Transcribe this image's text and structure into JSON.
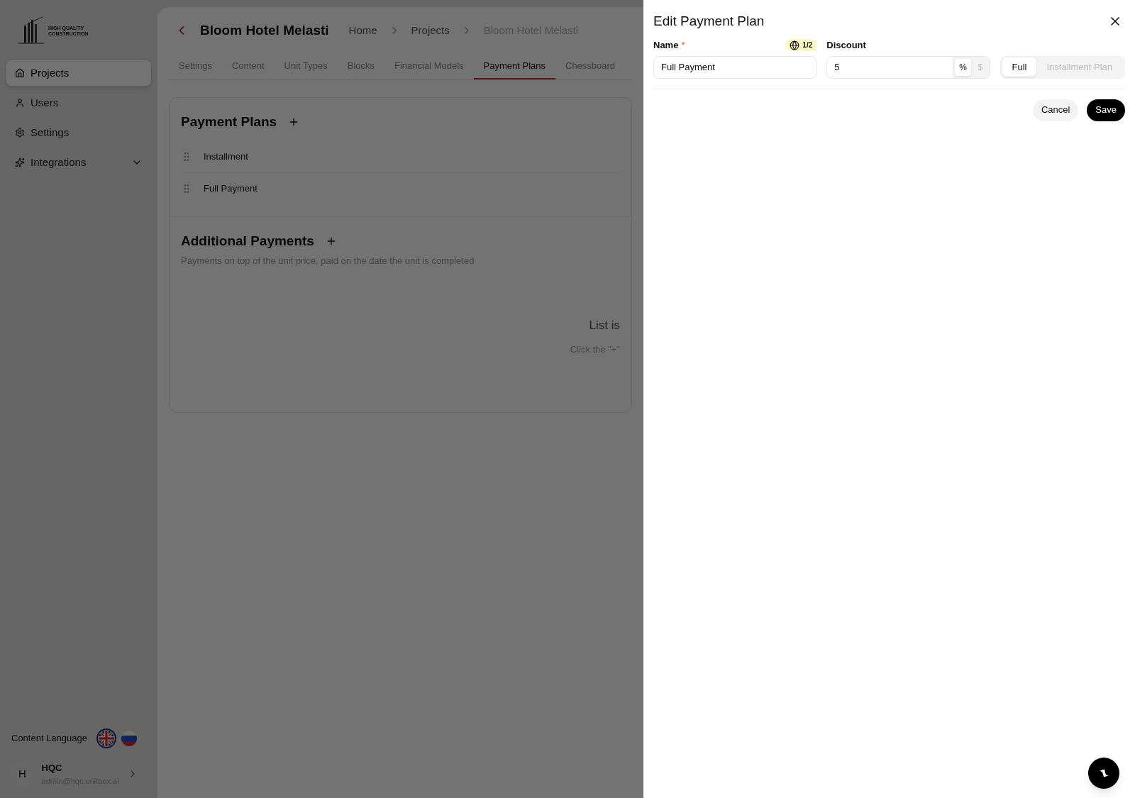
{
  "sidebar": {
    "logo_text": [
      "HIGH QUALITY",
      "CONSTRUCTION"
    ],
    "items": [
      {
        "label": "Projects",
        "selected": true
      },
      {
        "label": "Users",
        "selected": false
      },
      {
        "label": "Settings",
        "selected": false
      },
      {
        "label": "Integrations",
        "selected": false,
        "expanded": false
      }
    ],
    "content_language": {
      "label": "Content Language",
      "languages": [
        {
          "selected": true
        },
        {
          "selected": false
        }
      ]
    },
    "profile": {
      "initial": "H",
      "name": "HQC",
      "email": "admin@hqc.unitbox.ai"
    }
  },
  "header": {
    "title": "Bloom Hotel Melasti",
    "breadcrumbs": [
      "Home",
      "Projects",
      "Bloom Hotel Melasti"
    ]
  },
  "tabs": [
    {
      "label": "Settings",
      "selected": false
    },
    {
      "label": "Content",
      "selected": false
    },
    {
      "label": "Unit Types",
      "selected": false
    },
    {
      "label": "Blocks",
      "selected": false
    },
    {
      "label": "Financial Models",
      "selected": false
    },
    {
      "label": "Payment Plans",
      "selected": true
    },
    {
      "label": "Chessboard",
      "selected": false
    }
  ],
  "payment_plans": {
    "title": "Payment Plans",
    "items": [
      "Installment",
      "Full Payment"
    ]
  },
  "additional_payments": {
    "title": "Additional Payments",
    "description": "Payments on top of the unit price, paid on the date the unit is completed",
    "empty_title": "List is",
    "empty_hint": "Click the \"+\""
  },
  "drawer": {
    "title": "Edit Payment Plan",
    "name_field": {
      "label": "Name",
      "required_mark": "*",
      "translation_badge": "1/2",
      "value": "Full Payment"
    },
    "discount_field": {
      "label": "Discount",
      "value": "5",
      "units": [
        {
          "label": "%",
          "selected": true
        },
        {
          "label": "$",
          "selected": false
        }
      ]
    },
    "plan_type": [
      {
        "label": "Full",
        "selected": true
      },
      {
        "label": "Installment Plan",
        "selected": false
      }
    ],
    "buttons": [
      {
        "label": "Cancel",
        "kind": "secondary"
      },
      {
        "label": "Save",
        "kind": "primary"
      }
    ]
  }
}
